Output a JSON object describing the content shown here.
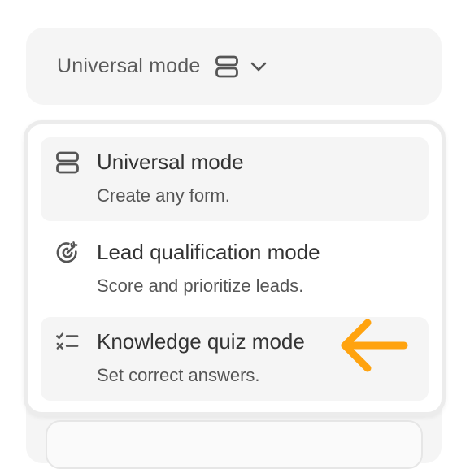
{
  "selector": {
    "label": "Universal mode",
    "icon": "universal-mode-icon",
    "chevron": "chevron-down-icon"
  },
  "options": [
    {
      "title": "Universal mode",
      "description": "Create any form.",
      "icon": "universal-mode-icon",
      "highlighted": true
    },
    {
      "title": "Lead qualification mode",
      "description": "Score and prioritize leads.",
      "icon": "target-icon",
      "highlighted": false
    },
    {
      "title": "Knowledge quiz mode",
      "description": "Set correct answers.",
      "icon": "quiz-checklist-icon",
      "highlighted": true
    }
  ],
  "annotation": {
    "icon": "arrow-left-icon",
    "color": "#ffa30f"
  },
  "colors": {
    "panel": "#f5f5f5",
    "text_primary": "#333333",
    "text_secondary": "#555555",
    "icon": "#555555"
  }
}
